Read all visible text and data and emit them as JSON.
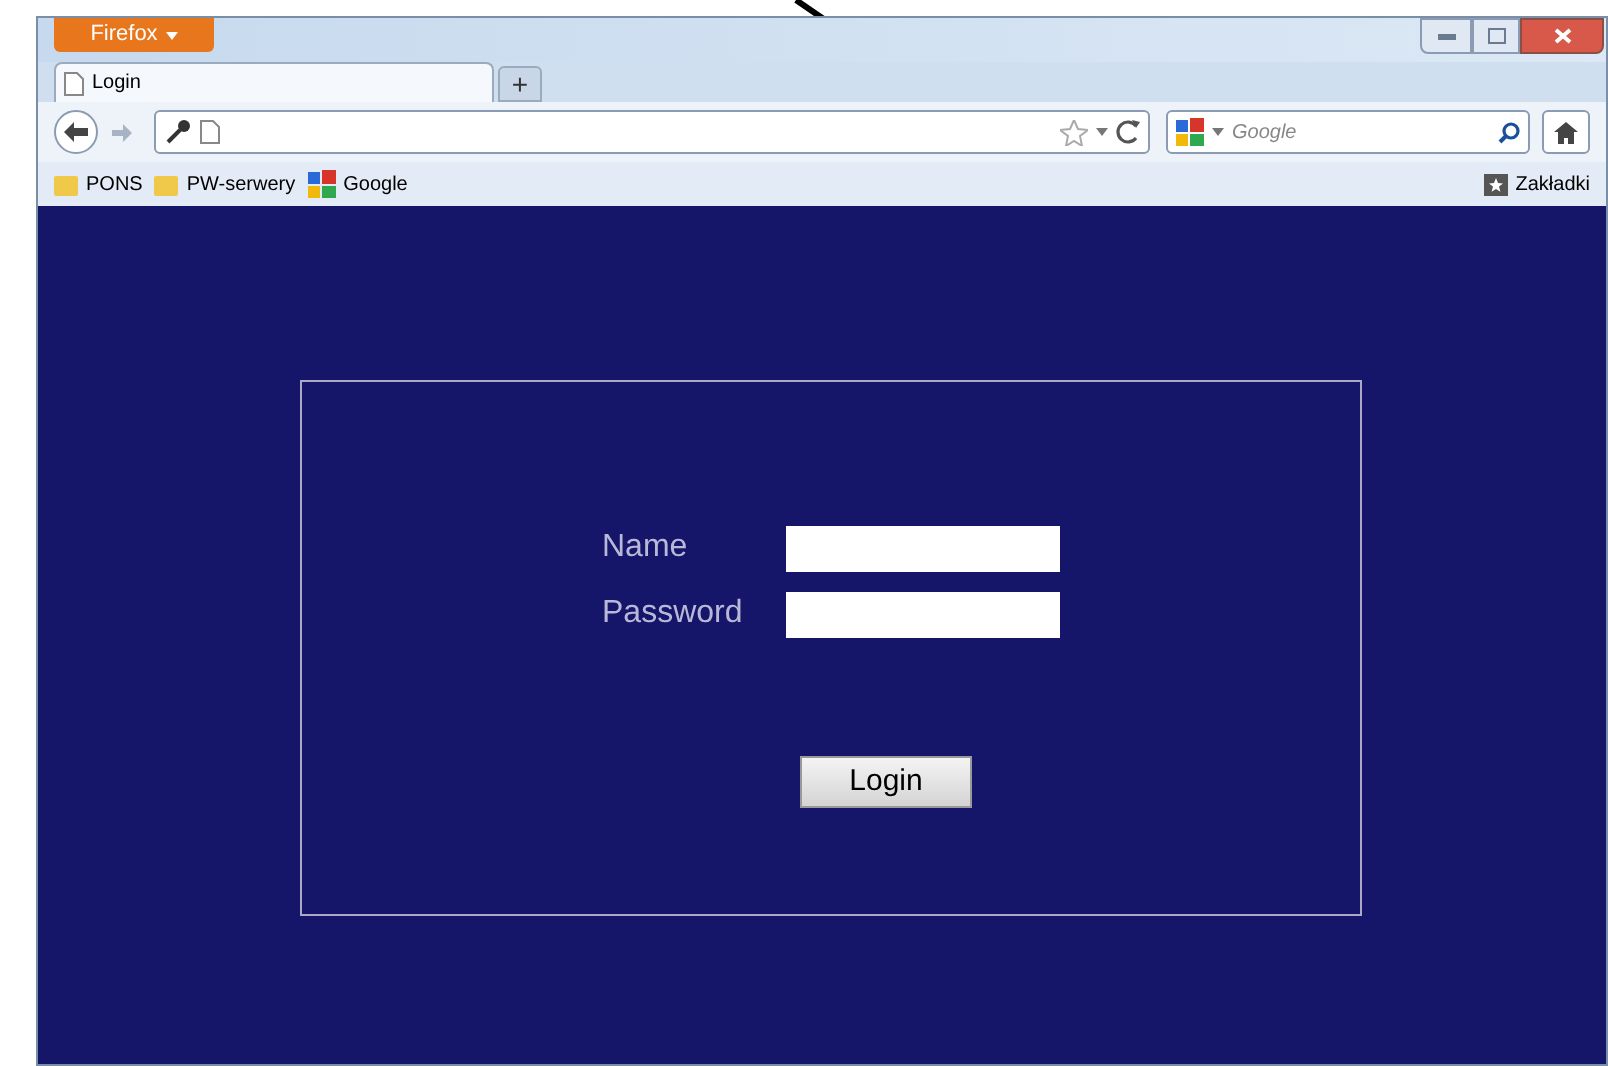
{
  "app_button": {
    "label": "Firefox"
  },
  "tabs": [
    {
      "label": "Login",
      "selected": true
    }
  ],
  "new_tab": "+",
  "search": {
    "placeholder": "Google"
  },
  "bookmarks": [
    {
      "label": "PONS",
      "kind": "folder"
    },
    {
      "label": "PW-serwery",
      "kind": "folder"
    },
    {
      "label": "Google",
      "kind": "site"
    }
  ],
  "bookmarks_menu": "Zakładki",
  "form": {
    "fields": [
      {
        "label": "Name"
      },
      {
        "label": "Password"
      }
    ],
    "button": "Login"
  }
}
